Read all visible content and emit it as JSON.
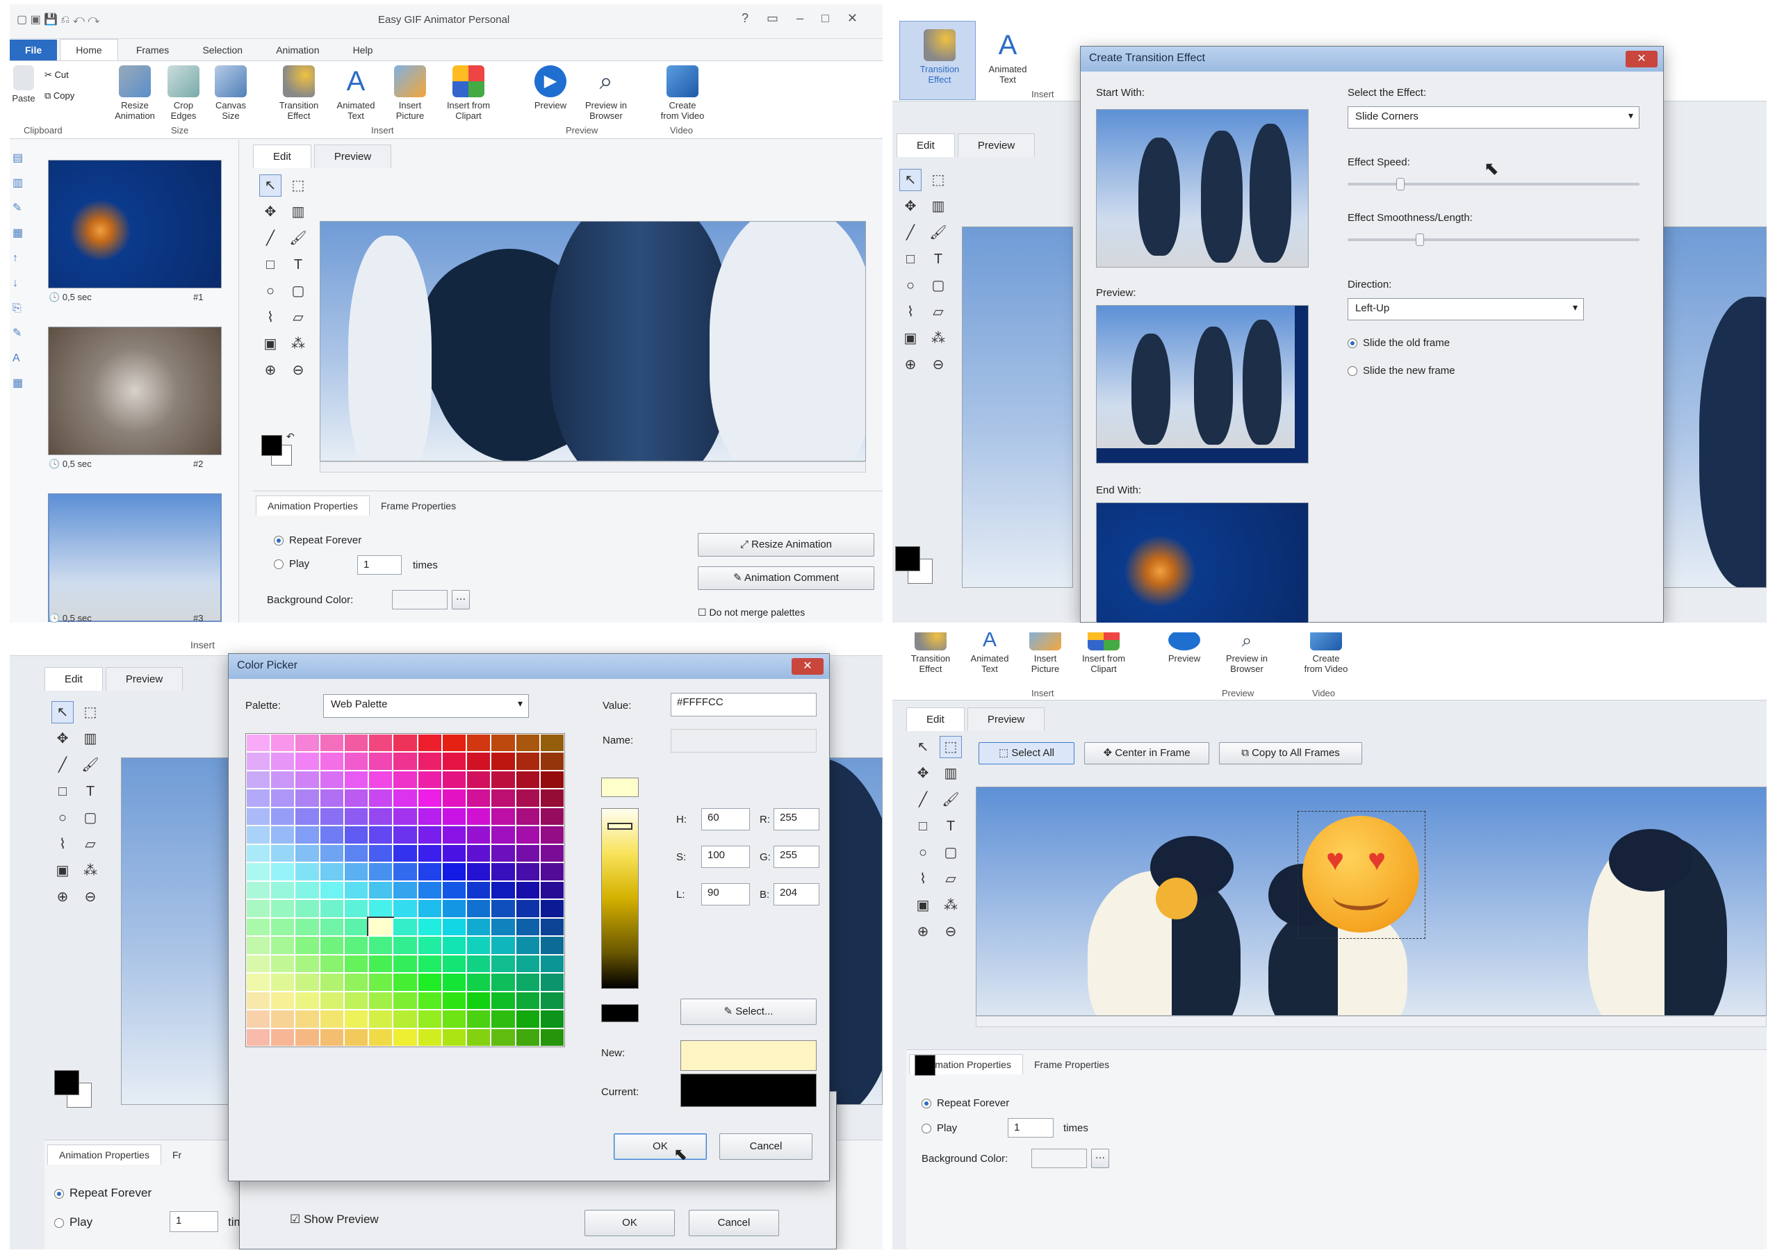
{
  "q1": {
    "window_title": "Easy GIF Animator Personal",
    "tabs": [
      "File",
      "Home",
      "Frames",
      "Selection",
      "Animation",
      "Help"
    ],
    "ribbon": {
      "clipboard": {
        "paste": "Paste",
        "cut": "Cut",
        "copy": "Copy",
        "group": "Clipboard"
      },
      "size": {
        "resize": "Resize\nAnimation",
        "crop": "Crop\nEdges",
        "canvas": "Canvas\nSize",
        "group": "Size"
      },
      "insert": {
        "transition": "Transition\nEffect",
        "animated_text": "Animated\nText",
        "insert_picture": "Insert\nPicture",
        "insert_clipart": "Insert from\nClipart",
        "group": "Insert"
      },
      "preview": {
        "preview": "Preview",
        "preview_browser": "Preview in\nBrowser",
        "group": "Preview"
      },
      "video": {
        "create": "Create\nfrom Video",
        "group": "Video"
      }
    },
    "frames": [
      {
        "duration": "0,5 sec",
        "index": "#1",
        "subject": "jellyfish"
      },
      {
        "duration": "0,5 sec",
        "index": "#2",
        "subject": "koala"
      },
      {
        "duration": "0,5 sec",
        "index": "#3",
        "subject": "penguins"
      }
    ],
    "editor_tabs": [
      "Edit",
      "Preview"
    ],
    "prop_tabs": [
      "Animation Properties",
      "Frame Properties"
    ],
    "repeat_forever": "Repeat Forever",
    "play": "Play",
    "play_times": "1",
    "times": "times",
    "bg_color": "Background Color:",
    "resize_btn": "Resize Animation",
    "comment_btn": "Animation Comment",
    "no_merge": "Do not merge palettes"
  },
  "q2": {
    "ribbon_partial": {
      "transition": "Transition\nEffect",
      "animated_text": "Animated\nText",
      "group": "Insert"
    },
    "editor_tabs": [
      "Edit",
      "Preview"
    ],
    "dialog": {
      "title": "Create Transition Effect",
      "start_with": "Start With:",
      "preview": "Preview:",
      "end_with": "End With:",
      "select_effect": "Select the Effect:",
      "effect_value": "Slide Corners",
      "effect_speed": "Effect Speed:",
      "effect_smooth": "Effect Smoothness/Length:",
      "direction": "Direction:",
      "direction_value": "Left-Up",
      "slide_old": "Slide the old frame",
      "slide_new": "Slide the new frame"
    }
  },
  "q3": {
    "insert_label": "Insert",
    "editor_tabs": [
      "Edit",
      "Preview"
    ],
    "dialog": {
      "title": "Color Picker",
      "palette_label": "Palette:",
      "palette_value": "Web Palette",
      "value_label": "Value:",
      "value": "#FFFFCC",
      "name_label": "Name:",
      "h_label": "H:",
      "h": "60",
      "s_label": "S:",
      "s": "100",
      "l_label": "L:",
      "l": "90",
      "r_label": "R:",
      "r": "255",
      "g_label": "G:",
      "g": "255",
      "b_label": "B:",
      "b": "204",
      "select_btn": "Select...",
      "new_label": "New:",
      "current_label": "Current:",
      "ok": "OK",
      "cancel": "Cancel",
      "new_color": "#FFF4C4",
      "current_color": "#000000"
    },
    "prop_tabs": [
      "Animation Properties",
      "Fr"
    ],
    "repeat_forever": "Repeat Forever",
    "play": "Play",
    "play_times": "1",
    "times": "tim",
    "show_preview": "Show Preview",
    "ok": "OK",
    "cancel": "Cancel"
  },
  "q4": {
    "ribbon": {
      "transition": "Transition\nEffect",
      "animated_text": "Animated\nText",
      "insert_picture": "Insert\nPicture",
      "insert_clipart": "Insert from\nClipart",
      "preview": "Preview",
      "preview_browser": "Preview in\nBrowser",
      "create": "Create\nfrom Video",
      "g_insert": "Insert",
      "g_preview": "Preview",
      "g_video": "Video"
    },
    "editor_tabs": [
      "Edit",
      "Preview"
    ],
    "select_all": "Select All",
    "center": "Center in Frame",
    "copy_all": "Copy to All Frames",
    "prop_tabs": [
      "Animation Properties",
      "Frame Properties"
    ],
    "repeat_forever": "Repeat Forever",
    "play": "Play",
    "play_times": "1",
    "times": "times",
    "bg_color": "Background Color:"
  }
}
